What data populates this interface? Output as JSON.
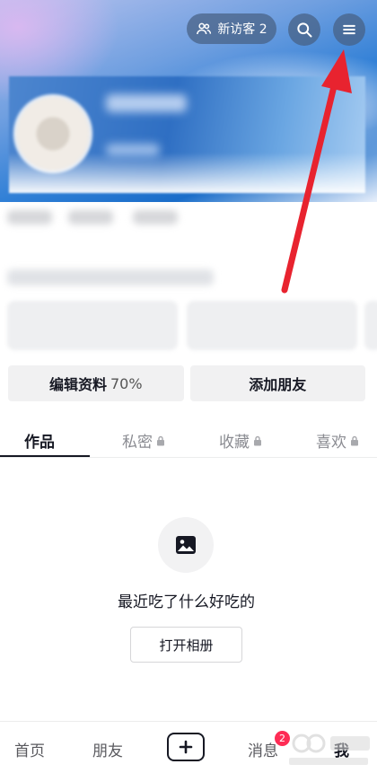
{
  "header": {
    "visitors_label": "新访客 2",
    "icons": [
      "people-icon",
      "search-icon",
      "menu-icon"
    ]
  },
  "actions": {
    "edit_profile": "编辑资料",
    "edit_profile_percent": "70%",
    "add_friend": "添加朋友"
  },
  "tabs": [
    {
      "label": "作品",
      "locked": false,
      "active": true
    },
    {
      "label": "私密",
      "locked": true,
      "active": false
    },
    {
      "label": "收藏",
      "locked": true,
      "active": false
    },
    {
      "label": "喜欢",
      "locked": true,
      "active": false
    }
  ],
  "empty_state": {
    "icon": "image-icon",
    "title": "最近吃了什么好吃的",
    "button": "打开相册"
  },
  "bottom_nav": {
    "home": "首页",
    "friends": "朋友",
    "messages": "消息",
    "messages_badge": "2",
    "me": "我"
  },
  "colors": {
    "annotation_arrow": "#e8232f",
    "badge": "#fe2c55",
    "text": "#161823"
  }
}
